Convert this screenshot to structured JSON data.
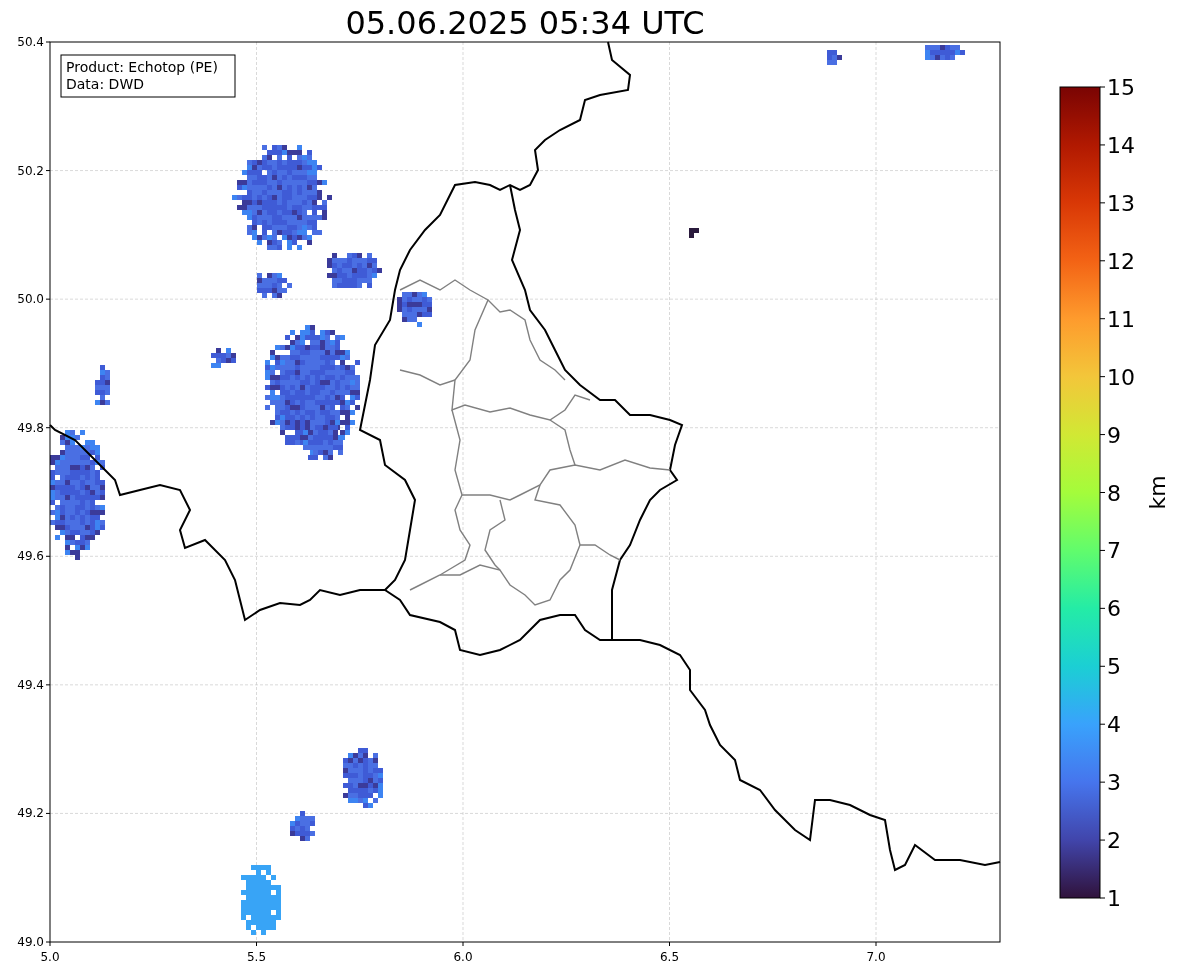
{
  "title": "05.06.2025 05:34 UTC",
  "map": {
    "info_lines": [
      "Product: Echotop (PE)",
      "Data: DWD"
    ],
    "xticks": [
      "5.0",
      "5.5",
      "6.0",
      "6.5",
      "7.0"
    ],
    "yticks": [
      "50.4",
      "50.2",
      "50.0",
      "49.8",
      "49.6",
      "49.4",
      "49.2",
      "49.0"
    ]
  },
  "colorbar": {
    "ticks": [
      "15",
      "14",
      "13",
      "12",
      "11",
      "10",
      "9",
      "8",
      "7",
      "6",
      "5",
      "4",
      "3",
      "2",
      "1"
    ],
    "label": "km"
  }
}
